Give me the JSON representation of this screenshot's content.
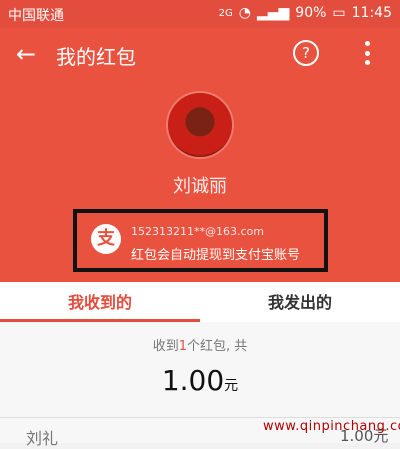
{
  "status": {
    "carrier": "中国联通",
    "battery": "90%",
    "time": "11:45",
    "network": "2G"
  },
  "appbar": {
    "back_icon": "←",
    "title": "我的红包",
    "help_icon": "?"
  },
  "profile": {
    "username": "刘诚丽",
    "alipay_email": "152313211**@163.com",
    "alipay_notice": "红包会自动提现到支付宝账号",
    "alipay_badge": "支"
  },
  "tabs": {
    "received": "我收到的",
    "sent": "我发出的"
  },
  "summary": {
    "prefix": "收到",
    "count": "1",
    "suffix": "个红包, 共",
    "amount": "1.00",
    "unit": "元"
  },
  "list": [
    {
      "label": "刘礼",
      "amount": "1.00元"
    }
  ],
  "watermark": "www.qinpinchang.com",
  "colors": {
    "brand": "#e9523f",
    "accent": "#e24d3d",
    "highlight_box": "#111111"
  }
}
